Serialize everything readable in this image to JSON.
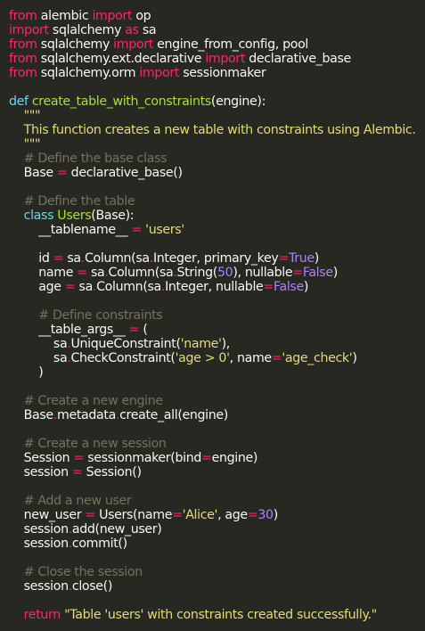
{
  "colors": {
    "background": "#272822",
    "plain": "#f8f8f2",
    "keyword": "#f92672",
    "def": "#66d9ef",
    "fname": "#a6e22e",
    "string": "#e6db74",
    "comment": "#75715e",
    "number": "#ae81ff",
    "const": "#ae81ff"
  },
  "code": {
    "lines": [
      [
        {
          "t": "keyword",
          "v": "from"
        },
        {
          "t": "plain",
          "v": " alembic "
        },
        {
          "t": "keyword",
          "v": "import"
        },
        {
          "t": "plain",
          "v": " op"
        }
      ],
      [
        {
          "t": "keyword",
          "v": "import"
        },
        {
          "t": "plain",
          "v": " sqlalchemy "
        },
        {
          "t": "keyword",
          "v": "as"
        },
        {
          "t": "plain",
          "v": " sa"
        }
      ],
      [
        {
          "t": "keyword",
          "v": "from"
        },
        {
          "t": "plain",
          "v": " sqlalchemy "
        },
        {
          "t": "keyword",
          "v": "import"
        },
        {
          "t": "plain",
          "v": " engine_from_config, pool"
        }
      ],
      [
        {
          "t": "keyword",
          "v": "from"
        },
        {
          "t": "plain",
          "v": " sqlalchemy.ext.declarative "
        },
        {
          "t": "keyword",
          "v": "import"
        },
        {
          "t": "plain",
          "v": " declarative_base"
        }
      ],
      [
        {
          "t": "keyword",
          "v": "from"
        },
        {
          "t": "plain",
          "v": " sqlalchemy.orm "
        },
        {
          "t": "keyword",
          "v": "import"
        },
        {
          "t": "plain",
          "v": " sessionmaker"
        }
      ],
      [],
      [
        {
          "t": "def",
          "v": "def"
        },
        {
          "t": "plain",
          "v": " "
        },
        {
          "t": "fname",
          "v": "create_table_with_constraints"
        },
        {
          "t": "plain",
          "v": "(engine):"
        }
      ],
      [
        {
          "t": "plain",
          "v": "    "
        },
        {
          "t": "string",
          "v": "\"\"\""
        }
      ],
      [
        {
          "t": "plain",
          "v": "    "
        },
        {
          "t": "string",
          "v": "This function creates a new table with constraints using Alembic."
        }
      ],
      [
        {
          "t": "plain",
          "v": "    "
        },
        {
          "t": "string",
          "v": "\"\"\""
        }
      ],
      [
        {
          "t": "plain",
          "v": "    "
        },
        {
          "t": "comment",
          "v": "# Define the base class"
        }
      ],
      [
        {
          "t": "plain",
          "v": "    Base "
        },
        {
          "t": "keyword",
          "v": "="
        },
        {
          "t": "plain",
          "v": " declarative_base()"
        }
      ],
      [],
      [
        {
          "t": "plain",
          "v": "    "
        },
        {
          "t": "comment",
          "v": "# Define the table"
        }
      ],
      [
        {
          "t": "plain",
          "v": "    "
        },
        {
          "t": "def",
          "v": "class"
        },
        {
          "t": "plain",
          "v": " "
        },
        {
          "t": "fname",
          "v": "Users"
        },
        {
          "t": "plain",
          "v": "(Base):"
        }
      ],
      [
        {
          "t": "plain",
          "v": "        __tablename__ "
        },
        {
          "t": "keyword",
          "v": "="
        },
        {
          "t": "plain",
          "v": " "
        },
        {
          "t": "string",
          "v": "'users'"
        }
      ],
      [],
      [
        {
          "t": "plain",
          "v": "        id "
        },
        {
          "t": "keyword",
          "v": "="
        },
        {
          "t": "plain",
          "v": " sa"
        },
        {
          "t": "keyword",
          "v": "."
        },
        {
          "t": "plain",
          "v": "Column(sa"
        },
        {
          "t": "keyword",
          "v": "."
        },
        {
          "t": "plain",
          "v": "Integer, primary_key"
        },
        {
          "t": "keyword",
          "v": "="
        },
        {
          "t": "const",
          "v": "True"
        },
        {
          "t": "plain",
          "v": ")"
        }
      ],
      [
        {
          "t": "plain",
          "v": "        name "
        },
        {
          "t": "keyword",
          "v": "="
        },
        {
          "t": "plain",
          "v": " sa"
        },
        {
          "t": "keyword",
          "v": "."
        },
        {
          "t": "plain",
          "v": "Column(sa"
        },
        {
          "t": "keyword",
          "v": "."
        },
        {
          "t": "plain",
          "v": "String("
        },
        {
          "t": "number",
          "v": "50"
        },
        {
          "t": "plain",
          "v": "), nullable"
        },
        {
          "t": "keyword",
          "v": "="
        },
        {
          "t": "const",
          "v": "False"
        },
        {
          "t": "plain",
          "v": ")"
        }
      ],
      [
        {
          "t": "plain",
          "v": "        age "
        },
        {
          "t": "keyword",
          "v": "="
        },
        {
          "t": "plain",
          "v": " sa"
        },
        {
          "t": "keyword",
          "v": "."
        },
        {
          "t": "plain",
          "v": "Column(sa"
        },
        {
          "t": "keyword",
          "v": "."
        },
        {
          "t": "plain",
          "v": "Integer, nullable"
        },
        {
          "t": "keyword",
          "v": "="
        },
        {
          "t": "const",
          "v": "False"
        },
        {
          "t": "plain",
          "v": ")"
        }
      ],
      [],
      [
        {
          "t": "plain",
          "v": "        "
        },
        {
          "t": "comment",
          "v": "# Define constraints"
        }
      ],
      [
        {
          "t": "plain",
          "v": "        __table_args__ "
        },
        {
          "t": "keyword",
          "v": "="
        },
        {
          "t": "plain",
          "v": " ("
        }
      ],
      [
        {
          "t": "plain",
          "v": "            sa"
        },
        {
          "t": "keyword",
          "v": "."
        },
        {
          "t": "plain",
          "v": "UniqueConstraint("
        },
        {
          "t": "string",
          "v": "'name'"
        },
        {
          "t": "plain",
          "v": "),"
        }
      ],
      [
        {
          "t": "plain",
          "v": "            sa"
        },
        {
          "t": "keyword",
          "v": "."
        },
        {
          "t": "plain",
          "v": "CheckConstraint("
        },
        {
          "t": "string",
          "v": "'age > 0'"
        },
        {
          "t": "plain",
          "v": ", name"
        },
        {
          "t": "keyword",
          "v": "="
        },
        {
          "t": "string",
          "v": "'age_check'"
        },
        {
          "t": "plain",
          "v": ")"
        }
      ],
      [
        {
          "t": "plain",
          "v": "        )"
        }
      ],
      [],
      [
        {
          "t": "plain",
          "v": "    "
        },
        {
          "t": "comment",
          "v": "# Create a new engine"
        }
      ],
      [
        {
          "t": "plain",
          "v": "    Base"
        },
        {
          "t": "keyword",
          "v": "."
        },
        {
          "t": "plain",
          "v": "metadata"
        },
        {
          "t": "keyword",
          "v": "."
        },
        {
          "t": "plain",
          "v": "create_all(engine)"
        }
      ],
      [],
      [
        {
          "t": "plain",
          "v": "    "
        },
        {
          "t": "comment",
          "v": "# Create a new session"
        }
      ],
      [
        {
          "t": "plain",
          "v": "    Session "
        },
        {
          "t": "keyword",
          "v": "="
        },
        {
          "t": "plain",
          "v": " sessionmaker(bind"
        },
        {
          "t": "keyword",
          "v": "="
        },
        {
          "t": "plain",
          "v": "engine)"
        }
      ],
      [
        {
          "t": "plain",
          "v": "    session "
        },
        {
          "t": "keyword",
          "v": "="
        },
        {
          "t": "plain",
          "v": " Session()"
        }
      ],
      [],
      [
        {
          "t": "plain",
          "v": "    "
        },
        {
          "t": "comment",
          "v": "# Add a new user"
        }
      ],
      [
        {
          "t": "plain",
          "v": "    new_user "
        },
        {
          "t": "keyword",
          "v": "="
        },
        {
          "t": "plain",
          "v": " Users(name"
        },
        {
          "t": "keyword",
          "v": "="
        },
        {
          "t": "string",
          "v": "'Alice'"
        },
        {
          "t": "plain",
          "v": ", age"
        },
        {
          "t": "keyword",
          "v": "="
        },
        {
          "t": "number",
          "v": "30"
        },
        {
          "t": "plain",
          "v": ")"
        }
      ],
      [
        {
          "t": "plain",
          "v": "    session"
        },
        {
          "t": "keyword",
          "v": "."
        },
        {
          "t": "plain",
          "v": "add(new_user)"
        }
      ],
      [
        {
          "t": "plain",
          "v": "    session"
        },
        {
          "t": "keyword",
          "v": "."
        },
        {
          "t": "plain",
          "v": "commit()"
        }
      ],
      [],
      [
        {
          "t": "plain",
          "v": "    "
        },
        {
          "t": "comment",
          "v": "# Close the session"
        }
      ],
      [
        {
          "t": "plain",
          "v": "    session"
        },
        {
          "t": "keyword",
          "v": "."
        },
        {
          "t": "plain",
          "v": "close()"
        }
      ],
      [],
      [
        {
          "t": "plain",
          "v": "    "
        },
        {
          "t": "keyword",
          "v": "return"
        },
        {
          "t": "plain",
          "v": " "
        },
        {
          "t": "string",
          "v": "\"Table 'users' with constraints created successfully.\""
        }
      ]
    ]
  }
}
